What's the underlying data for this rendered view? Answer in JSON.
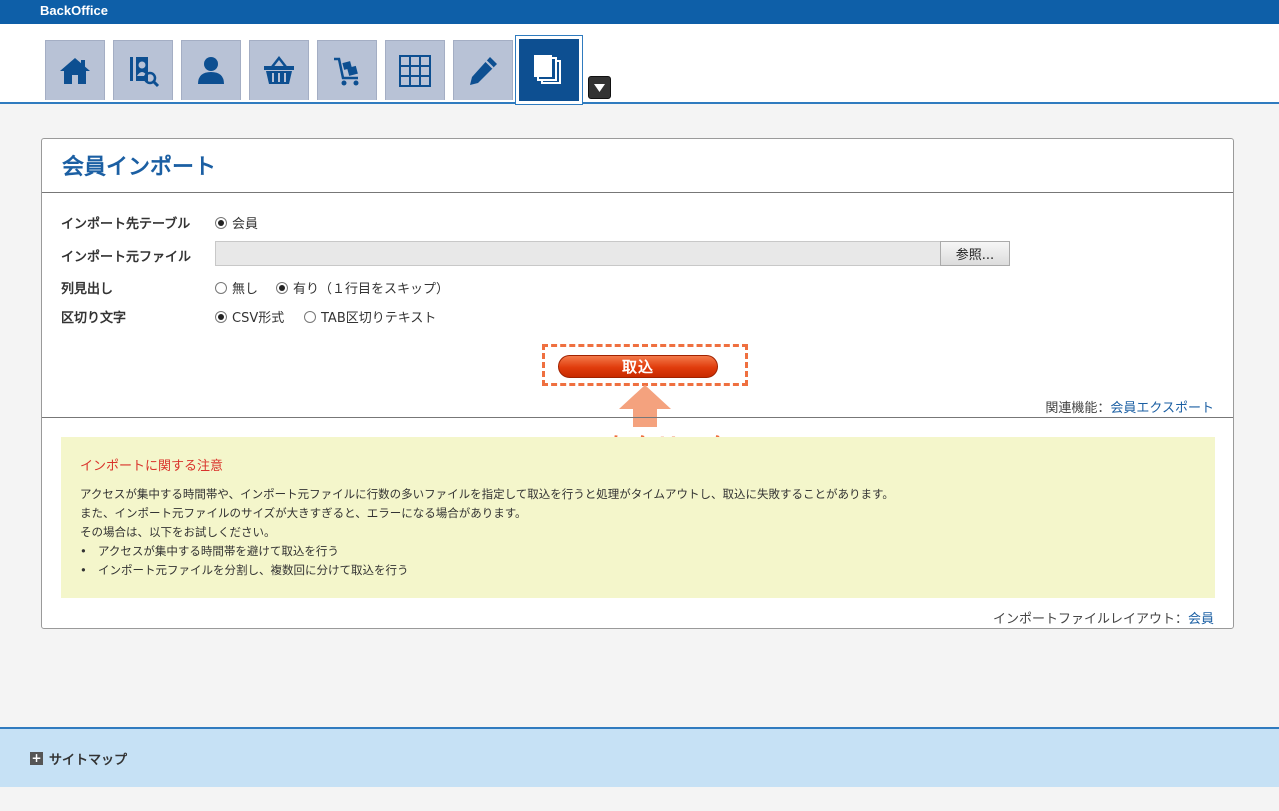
{
  "header": {
    "brand": "BackOffice"
  },
  "nav": {
    "tabs": [
      {
        "name": "home-icon"
      },
      {
        "name": "member-search-icon"
      },
      {
        "name": "person-icon"
      },
      {
        "name": "basket-icon"
      },
      {
        "name": "cart-icon"
      },
      {
        "name": "grid-icon"
      },
      {
        "name": "pencil-icon"
      },
      {
        "name": "documents-icon",
        "active": true
      }
    ]
  },
  "panel": {
    "title": "会員インポート",
    "fields": {
      "target_table_label": "インポート先テーブル",
      "target_table_option": "会員",
      "source_file_label": "インポート元ファイル",
      "browse_label": "参照...",
      "header_label": "列見出し",
      "header_none": "無し",
      "header_yes": "有り（１行目をスキップ）",
      "delimiter_label": "区切り文字",
      "delimiter_csv": "CSV形式",
      "delimiter_tab": "TAB区切りテキスト"
    },
    "import_button": "取込",
    "callout": "ココをクリック",
    "related_prefix": "関連機能：",
    "related_link": "会員エクスポート",
    "notice": {
      "title": "インポートに関する注意",
      "lines": [
        "アクセスが集中する時間帯や、インポート元ファイルに行数の多いファイルを指定して取込を行うと処理がタイムアウトし、取込に失敗することがあります。",
        "また、インポート元ファイルのサイズが大きすぎると、エラーになる場合があります。",
        "その場合は、以下をお試しください。"
      ],
      "bullets": [
        "アクセスが集中する時間帯を避けて取込を行う",
        "インポート元ファイルを分割し、複数回に分けて取込を行う"
      ]
    },
    "layout_prefix": "インポートファイルレイアウト：",
    "layout_link": "会員"
  },
  "footer": {
    "sitemap": "サイトマップ"
  },
  "colors": {
    "primary": "#0e5fa8",
    "accent": "#ef6f3e",
    "notice_bg": "#f4f6cb"
  }
}
